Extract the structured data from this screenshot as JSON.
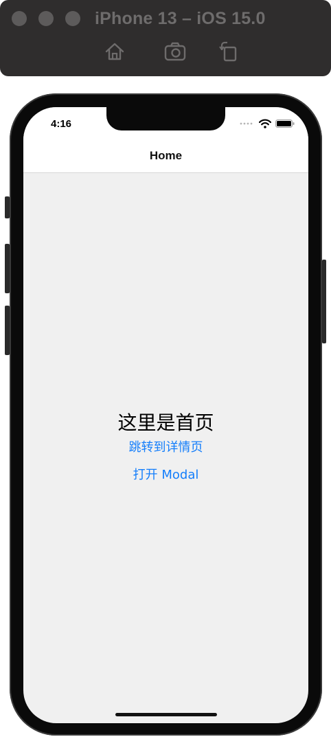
{
  "simulator": {
    "title": "iPhone 13 – iOS 15.0",
    "toolbar_icons": [
      "home-icon",
      "screenshot-icon",
      "rotate-icon"
    ],
    "window_controls": [
      "close",
      "minimize",
      "zoom"
    ]
  },
  "status_bar": {
    "time": "4:16",
    "icons": [
      "signal-dots-icon",
      "wifi-icon",
      "battery-icon"
    ]
  },
  "nav": {
    "title": "Home"
  },
  "content": {
    "headline": "这里是首页",
    "detail_link": "跳转到详情页",
    "modal_link": "打开 Modal"
  },
  "colors": {
    "link": "#147efb",
    "screen_background": "#f0f0f0",
    "titlebar": "#2f2d2d"
  }
}
